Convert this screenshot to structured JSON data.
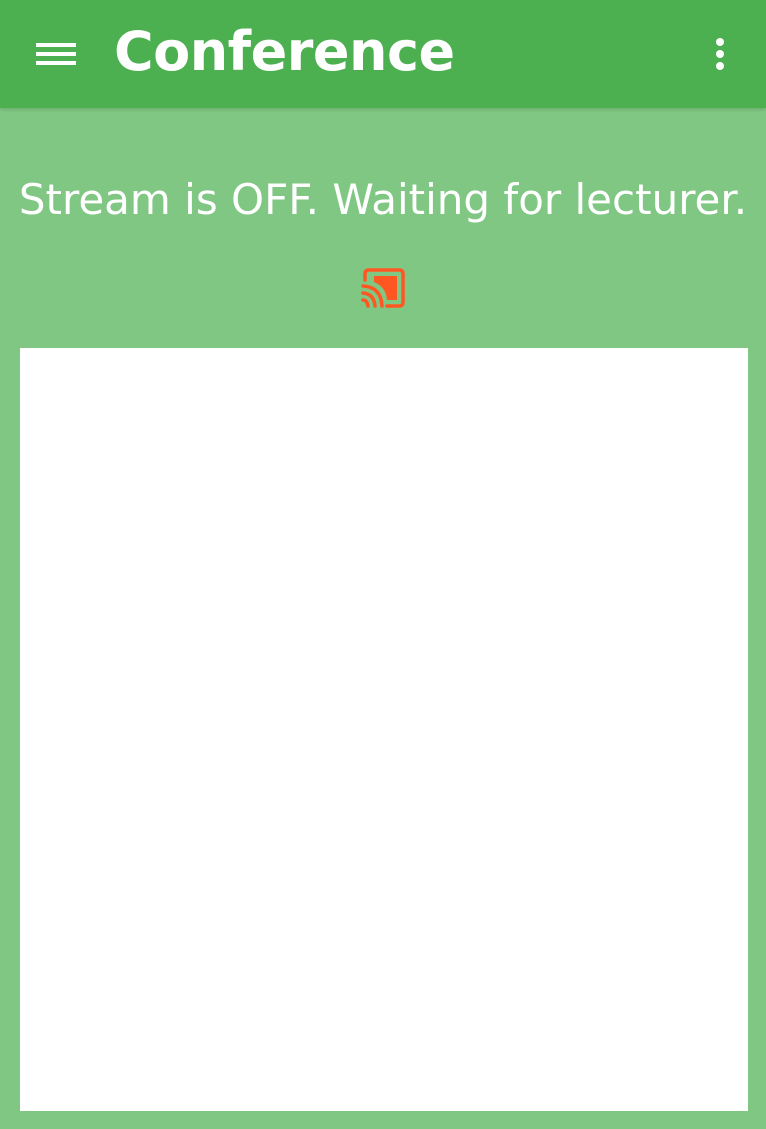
{
  "app_bar": {
    "title": "Conference",
    "background_color": "#4CAF50",
    "menu_icon": "hamburger-menu-icon",
    "overflow_icon": "more-vert-icon"
  },
  "main": {
    "background_color": "#81C784",
    "status_text": "Stream is OFF. Waiting for lecturer.",
    "cast_icon": "cast-connected-icon",
    "cast_icon_color": "#FF5722",
    "video_background_color": "#FFFFFF"
  }
}
